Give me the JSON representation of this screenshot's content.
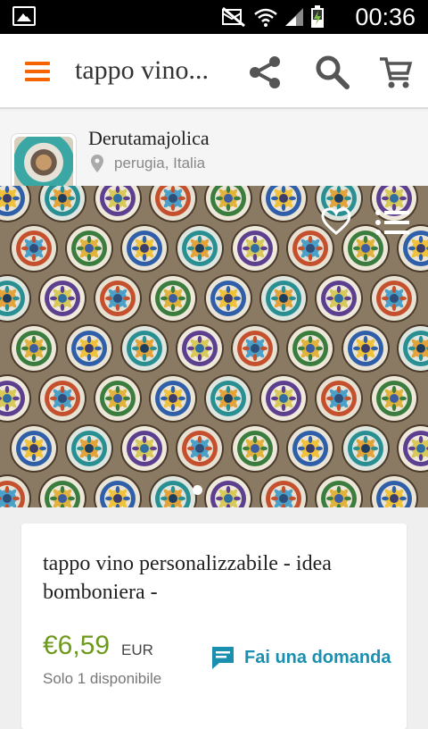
{
  "status_bar": {
    "time": "00:36",
    "icons": [
      "gallery-icon",
      "mute-icon",
      "wifi-icon",
      "signal-icon",
      "battery-charging-icon"
    ]
  },
  "app_bar": {
    "title": "tappo vino...",
    "icons": [
      "menu-icon",
      "share-icon",
      "search-icon",
      "cart-icon"
    ],
    "accent_color": "#f56400"
  },
  "shop": {
    "name": "Derutamajolica",
    "location": "perugia, Italia"
  },
  "gallery": {
    "icons": [
      "heart-outline-icon",
      "list-icon"
    ],
    "current_slide": 1
  },
  "product": {
    "title": "tappo vino personalizzabile - idea bomboniera -",
    "price": "€6,59",
    "currency": "EUR",
    "availability": "Solo 1 disponibile",
    "ask_label": "Fai una domanda",
    "price_color": "#6e9a1c",
    "link_color": "#1a8fb0"
  }
}
